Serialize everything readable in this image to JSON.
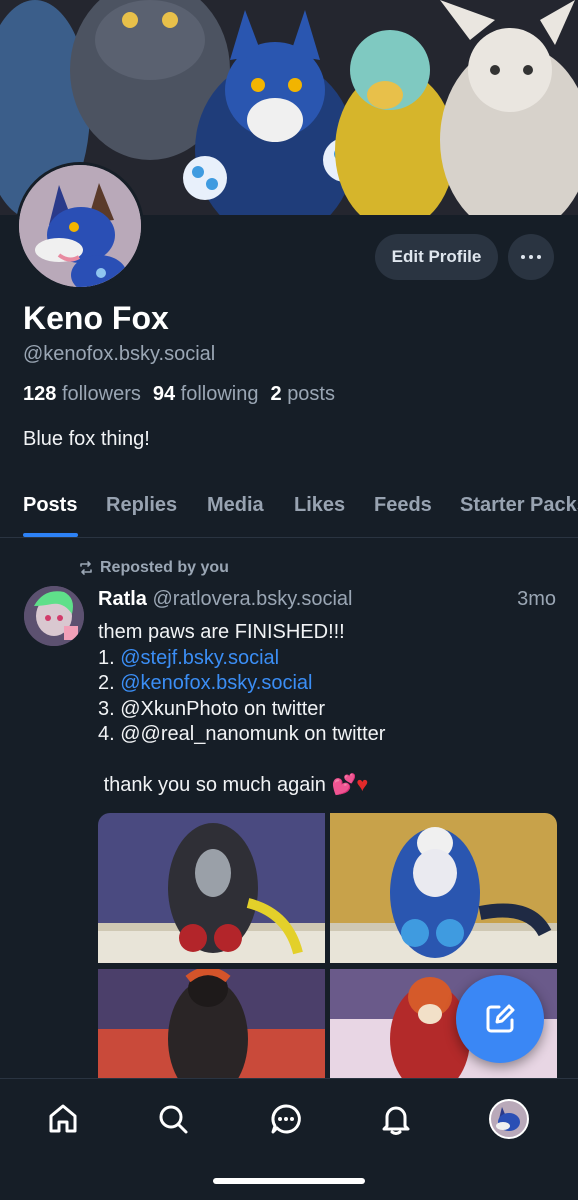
{
  "profile": {
    "name": "Keno Fox",
    "handle": "@kenofox.bsky.social",
    "followers_count": "128",
    "followers_label": "followers",
    "following_count": "94",
    "following_label": "following",
    "posts_count": "2",
    "posts_label": "posts",
    "bio": "Blue fox thing!",
    "edit_label": "Edit Profile"
  },
  "tabs": [
    {
      "label": "Posts",
      "active": true
    },
    {
      "label": "Replies"
    },
    {
      "label": "Media"
    },
    {
      "label": "Likes"
    },
    {
      "label": "Feeds"
    },
    {
      "label": "Starter Packs"
    }
  ],
  "post": {
    "repost_label": "Reposted by you",
    "author": "Ratla",
    "author_handle": "@ratlovera.bsky.social",
    "time": "3mo",
    "line1": "them paws are FINISHED!!!",
    "line2_prefix": "1. ",
    "line2_link": "@stejf.bsky.social",
    "line3_prefix": "2. ",
    "line3_link": "@kenofox.bsky.social",
    "line4": "3. @XkunPhoto on twitter",
    "line5": "4. @@real_nanomunk on twitter",
    "line6": "thank you so much again",
    "line6_emoji": "💕",
    "line6_heart": "♥"
  },
  "colors": {
    "background": "#161e27",
    "accent": "#2d82f6",
    "link": "#3b8ef5",
    "muted": "#9aa6b4"
  },
  "nav": {
    "icons": [
      "home-icon",
      "search-icon",
      "chat-icon",
      "bell-icon",
      "avatar"
    ]
  }
}
